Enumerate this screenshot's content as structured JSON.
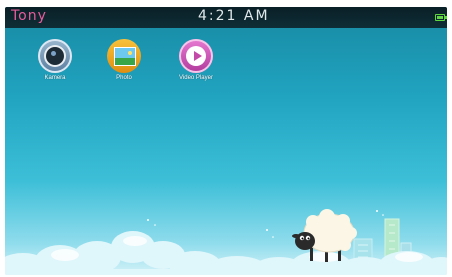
{
  "status_bar": {
    "user_name": "Tony",
    "time": "4:21 AM",
    "battery_icon": "battery-icon",
    "battery_color": "#5fd93f"
  },
  "apps": [
    {
      "label": "Kamera",
      "icon": "camera-icon"
    },
    {
      "label": "Photo",
      "icon": "photo-gallery-icon"
    },
    {
      "label": "Video Player",
      "icon": "video-player-icon"
    }
  ],
  "wallpaper": {
    "scene": "sheep-on-clouds",
    "sky_top_color": "#1789a3",
    "sky_bottom_color": "#d4f2f8",
    "user_name_color": "#e65c9c"
  }
}
